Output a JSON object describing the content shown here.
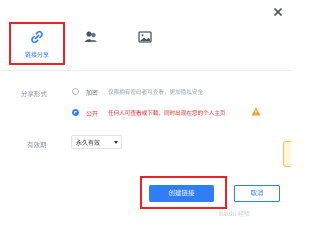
{
  "tabs": [
    {
      "label": "链接分享",
      "icon": "link-icon",
      "active": true
    },
    {
      "label": "",
      "icon": "group-icon",
      "active": false
    },
    {
      "label": "",
      "icon": "image-icon",
      "active": false
    }
  ],
  "close_icon": "close-icon",
  "share_form": {
    "label": "分享形式",
    "options": [
      {
        "name": "加密",
        "desc": "仅限拥有密码者可查看，更加隐私安全",
        "selected": false
      },
      {
        "name": "公开",
        "desc": "任何人可查看或下载，同时出现在您的个人主页",
        "selected": true
      }
    ]
  },
  "validity": {
    "label": "有效期",
    "value": "永久有效"
  },
  "buttons": {
    "create": "创建链接",
    "cancel": "取消"
  },
  "colors": {
    "accent": "#2f7ef5",
    "danger": "#e8232a",
    "warning": "#f0a020"
  }
}
